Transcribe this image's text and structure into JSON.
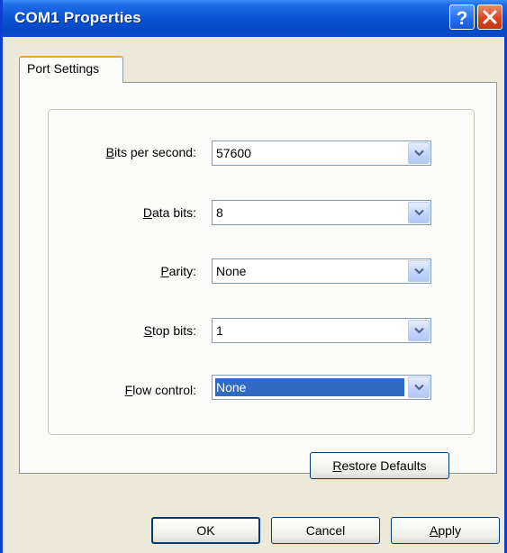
{
  "window": {
    "title": "COM1 Properties"
  },
  "titlebar": {
    "help_label": "?",
    "close_label": "✕"
  },
  "tabs": [
    {
      "label": "Port Settings",
      "active": true
    }
  ],
  "settings": {
    "bits_per_second": {
      "label_key": "B",
      "label_rest": "its per second:",
      "value": "57600"
    },
    "data_bits": {
      "label_key": "D",
      "label_rest": "ata bits:",
      "value": "8"
    },
    "parity": {
      "label_key": "P",
      "label_rest": "arity:",
      "value": "None"
    },
    "stop_bits": {
      "label_key": "S",
      "label_rest": "top bits:",
      "value": "1"
    },
    "flow_control": {
      "label_key": "F",
      "label_rest": "low control:",
      "value": "None"
    }
  },
  "restore": {
    "key": "R",
    "rest": "estore Defaults"
  },
  "footer": {
    "ok_label": "OK",
    "cancel_label": "Cancel",
    "apply_key": "A",
    "apply_rest": "pply"
  },
  "colors": {
    "titlebar": "#0a55d6",
    "selection": "#316ac5",
    "tab_highlight": "#f5a623"
  }
}
